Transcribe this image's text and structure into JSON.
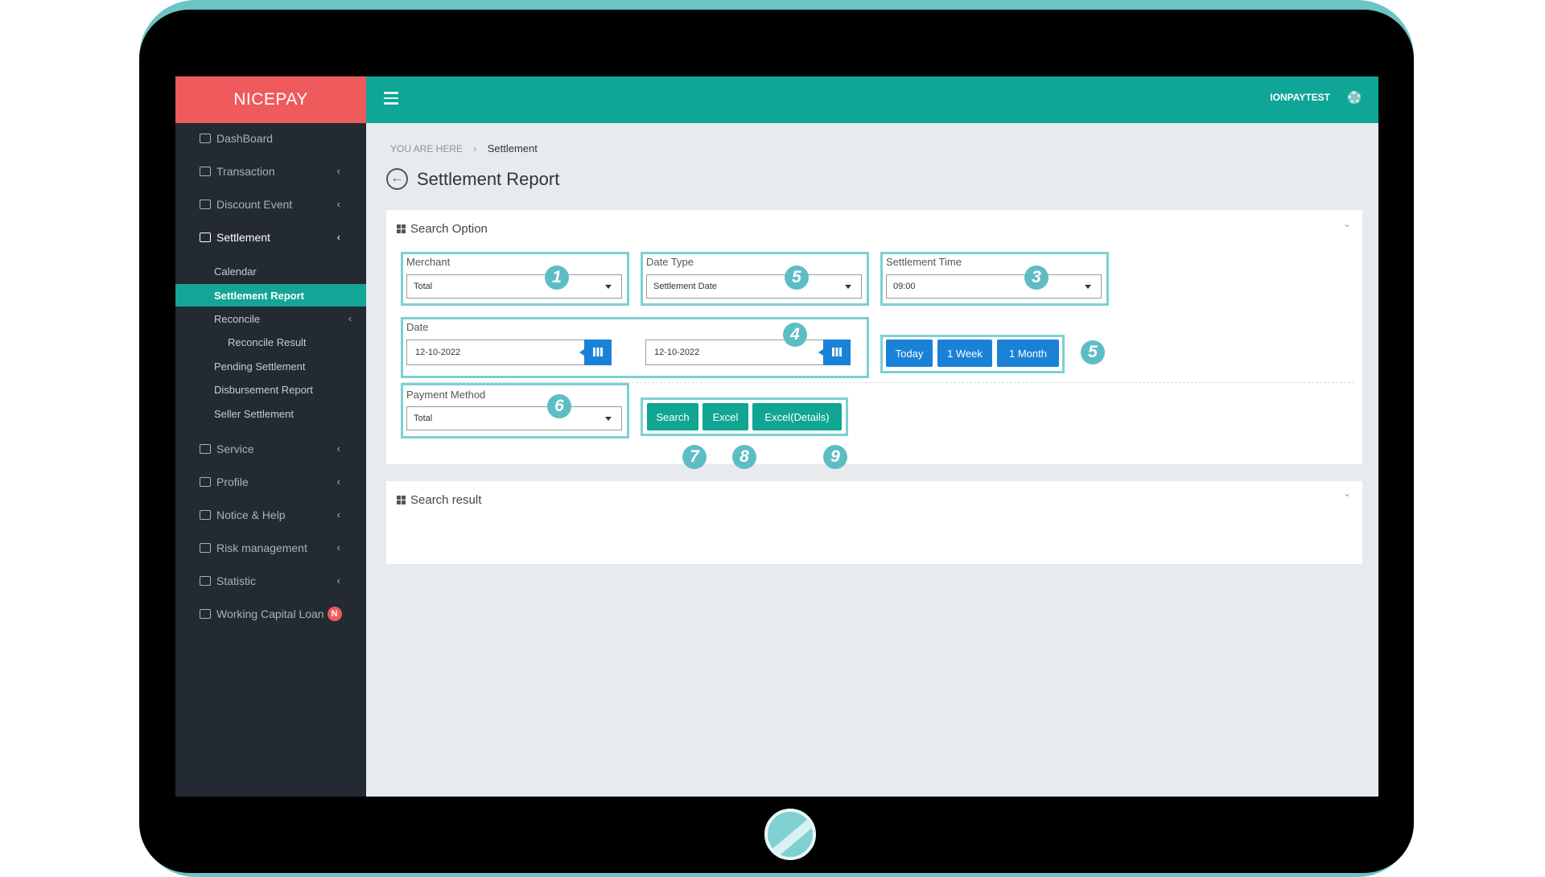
{
  "app": {
    "brand": "NICEPAY",
    "user": "IONPAYTEST"
  },
  "sidebar": {
    "items": [
      {
        "label": "DashBoard",
        "icon": "dashboard-icon"
      },
      {
        "label": "Transaction",
        "icon": "exchange-icon"
      },
      {
        "label": "Discount Event",
        "icon": "bar-chart-icon"
      },
      {
        "label": "Settlement",
        "icon": "calendar-icon"
      },
      {
        "label": "Service",
        "icon": "users-icon"
      },
      {
        "label": "Profile",
        "icon": "monitor-icon"
      },
      {
        "label": "Notice & Help",
        "icon": "comment-icon"
      },
      {
        "label": "Risk management",
        "icon": "folder-icon"
      },
      {
        "label": "Statistic",
        "icon": "folder-icon"
      },
      {
        "label": "Working Capital Loan",
        "icon": "folder-icon",
        "badge": "N"
      }
    ],
    "sub_items": [
      {
        "label": "Calendar"
      },
      {
        "label": "Settlement Report"
      },
      {
        "label": "Reconcile"
      },
      {
        "label": "Reconcile Result"
      },
      {
        "label": "Pending Settlement"
      },
      {
        "label": "Disbursement Report"
      },
      {
        "label": "Seller Settlement"
      }
    ]
  },
  "breadcrumb": {
    "prefix": "YOU ARE HERE",
    "separator": "›",
    "current": "Settlement"
  },
  "page": {
    "title": "Settlement Report"
  },
  "search_option": {
    "title": "Search Option",
    "merchant": {
      "label": "Merchant",
      "value": "Total"
    },
    "date_type": {
      "label": "Date Type",
      "value": "Settlement Date"
    },
    "settlement_time": {
      "label": "Settlement Time",
      "value": "09:00"
    },
    "date": {
      "label": "Date",
      "from": "12-10-2022",
      "to": "12-10-2022"
    },
    "quick_ranges": [
      "Today",
      "1 Week",
      "1 Month"
    ],
    "payment_method": {
      "label": "Payment Method",
      "value": "Total"
    },
    "actions": {
      "search": "Search",
      "excel": "Excel",
      "excel_details": "Excel(Details)"
    }
  },
  "search_result": {
    "title": "Search result"
  },
  "markers": [
    "1",
    "5",
    "3",
    "4",
    "5",
    "6",
    "7",
    "8",
    "9"
  ],
  "colors": {
    "brand": "#ef5a5c",
    "header": "#0fa597",
    "sidebar": "#232a32",
    "selected": "#13a596",
    "primary_button": "#1a82d6",
    "action_button": "#11a594",
    "callout": "#5ebdc4"
  }
}
